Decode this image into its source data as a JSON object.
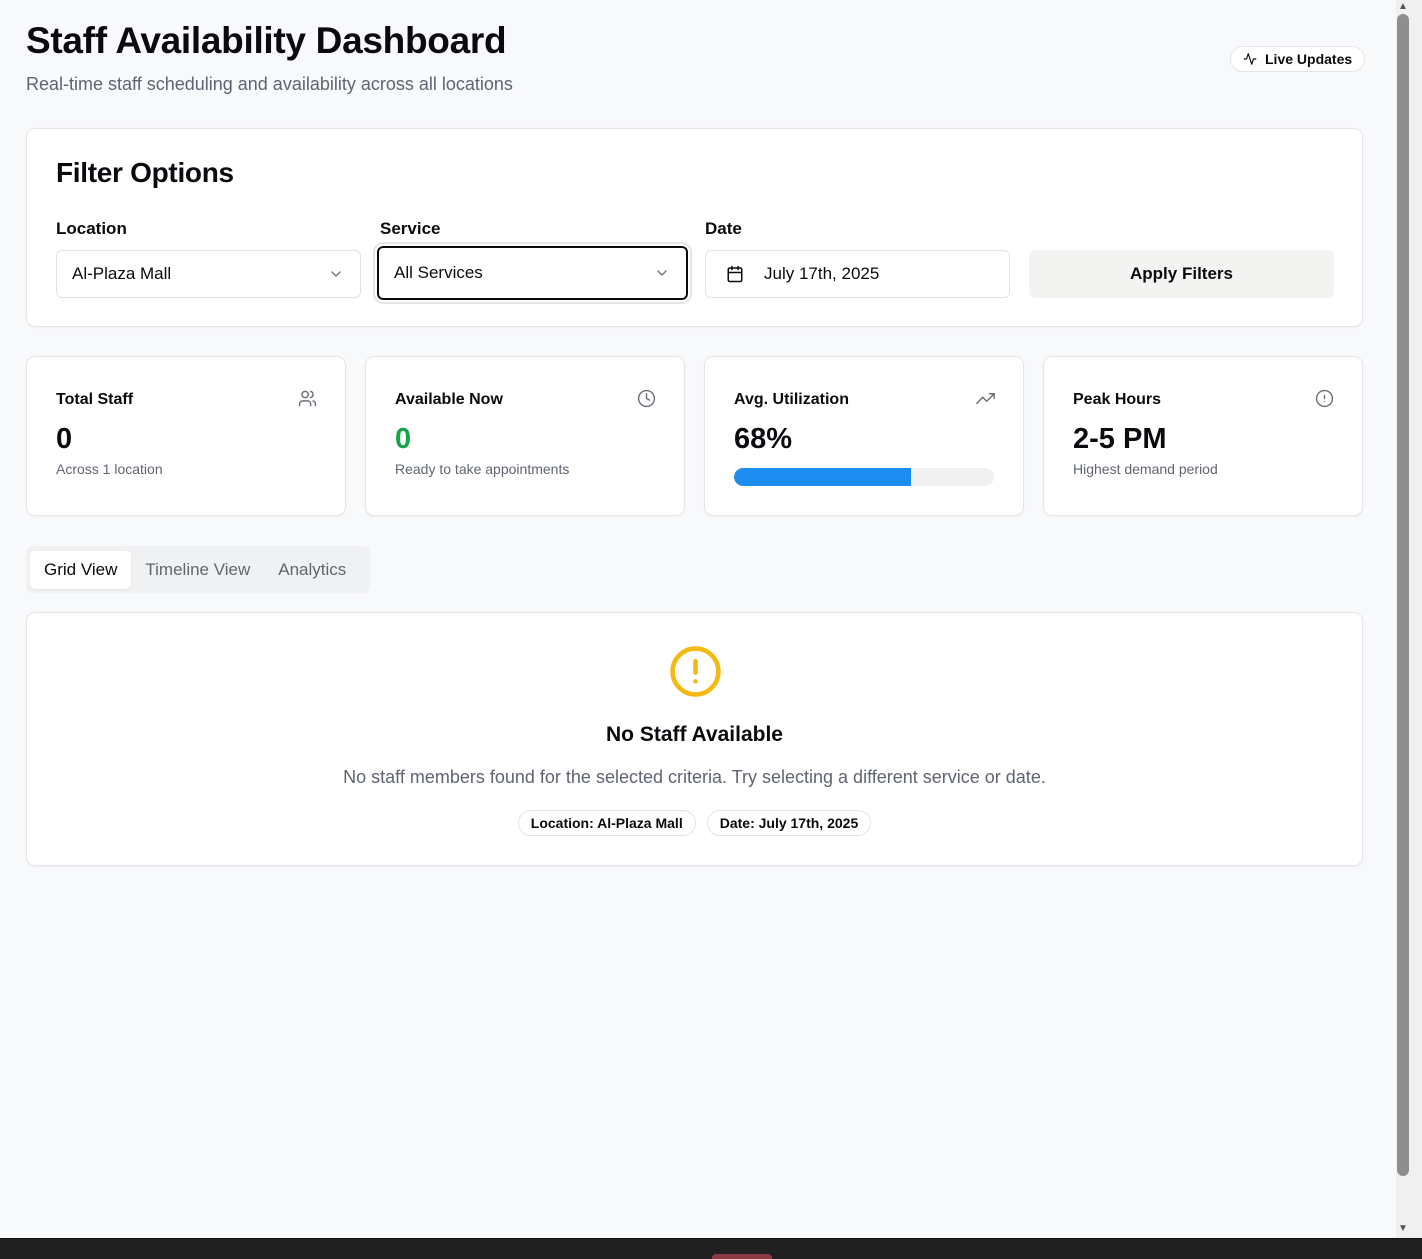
{
  "header": {
    "title": "Staff Availability Dashboard",
    "subtitle": "Real-time staff scheduling and availability across all locations",
    "live_badge": "Live Updates"
  },
  "filters": {
    "title": "Filter Options",
    "location_label": "Location",
    "location_value": "Al-Plaza Mall",
    "service_label": "Service",
    "service_value": "All Services",
    "date_label": "Date",
    "date_value": "July 17th, 2025",
    "apply_label": "Apply Filters"
  },
  "stats": {
    "total_staff": {
      "label": "Total Staff",
      "value": "0",
      "sub": "Across 1 location",
      "icon": "users-icon"
    },
    "available_now": {
      "label": "Available Now",
      "value": "0",
      "sub": "Ready to take appointments",
      "icon": "clock-icon",
      "value_color": "#16a34a"
    },
    "utilization": {
      "label": "Avg. Utilization",
      "value": "68%",
      "progress": 0.68,
      "icon": "trending-up-icon",
      "bar_color": "#1d8cf0"
    },
    "peak_hours": {
      "label": "Peak Hours",
      "value": "2-5 PM",
      "sub": "Highest demand period",
      "icon": "alert-circle-icon"
    }
  },
  "tabs": [
    {
      "label": "Grid View",
      "active": true
    },
    {
      "label": "Timeline View",
      "active": false
    },
    {
      "label": "Analytics",
      "active": false
    }
  ],
  "empty_state": {
    "icon": "warning-circle-icon",
    "icon_color": "#f5b915",
    "title": "No Staff Available",
    "description": "No staff members found for the selected criteria. Try selecting a different service or date.",
    "chips": [
      "Location: Al-Plaza Mall",
      "Date: July 17th, 2025"
    ]
  }
}
